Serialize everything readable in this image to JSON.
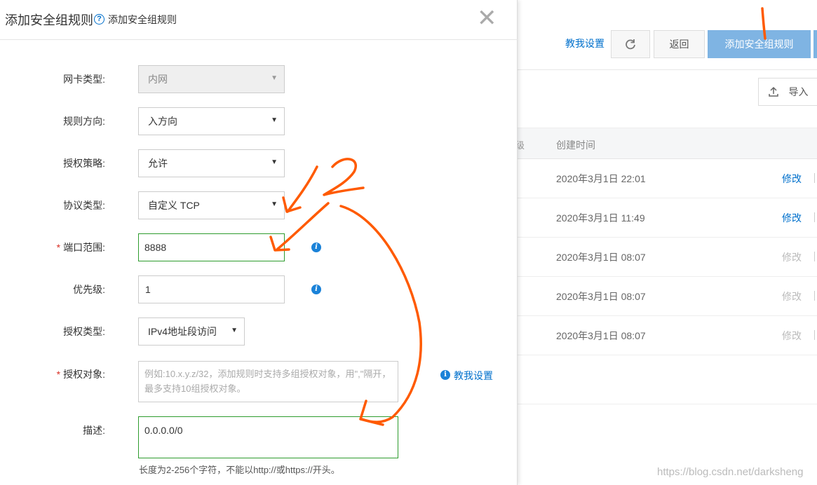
{
  "background": {
    "teach_link": "教我设置",
    "back_button": "返回",
    "add_rule_button": "添加安全组规则",
    "import_button": "导入",
    "column_level_partial": "级",
    "column_created": "创建时间",
    "rows": [
      {
        "time": "2020年3月1日 22:01",
        "action": "修改",
        "enabled": true
      },
      {
        "time": "2020年3月1日 11:49",
        "action": "修改",
        "enabled": true
      },
      {
        "time": "2020年3月1日 08:07",
        "action": "修改",
        "enabled": false
      },
      {
        "time": "2020年3月1日 08:07",
        "action": "修改",
        "enabled": false
      },
      {
        "time": "2020年3月1日 08:07",
        "action": "修改",
        "enabled": false
      }
    ],
    "watermark": "https://blog.csdn.net/darksheng"
  },
  "dialog": {
    "title": "添加安全组规则",
    "help_link": "添加安全组规则",
    "close_icon": "close-icon",
    "fields": {
      "nic_type": {
        "label": "网卡类型:",
        "value": "内网"
      },
      "direction": {
        "label": "规则方向:",
        "value": "入方向"
      },
      "policy": {
        "label": "授权策略:",
        "value": "允许"
      },
      "protocol": {
        "label": "协议类型:",
        "value": "自定义 TCP"
      },
      "port_range": {
        "label": "端口范围:",
        "value": "8888"
      },
      "priority": {
        "label": "优先级:",
        "value": "1"
      },
      "auth_type": {
        "label": "授权类型:",
        "value": "IPv4地址段访问"
      },
      "auth_object": {
        "label": "授权对象:",
        "placeholder": "例如:10.x.y.z/32，添加规则时支持多组授权对象，用\",\"隔开，最多支持10组授权对象。"
      },
      "description": {
        "label": "描述:",
        "value": "0.0.0.0/0"
      }
    },
    "teach_link": "教我设置",
    "description_hint": "长度为2-256个字符，不能以http://或https://开头。"
  },
  "colors": {
    "accent": "#0070cc",
    "add_button": "#7fb4e3",
    "annotation": "#ff5a00",
    "input_focus": "#2e9c2e"
  }
}
